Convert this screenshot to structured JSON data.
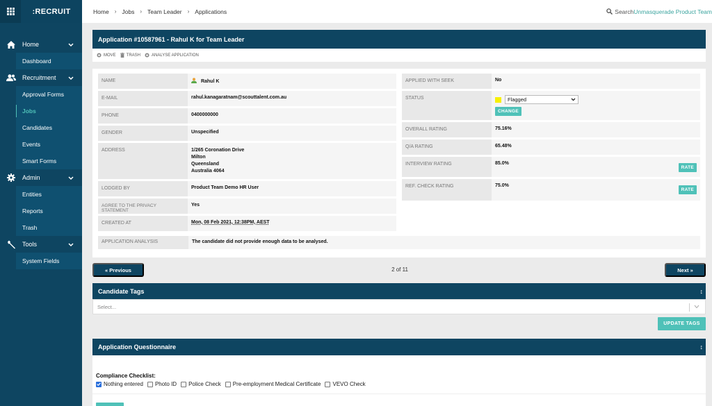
{
  "app": {
    "brand": ":RECRUIT"
  },
  "sidebar": {
    "groups": [
      {
        "label": "Home",
        "icon": "home-icon",
        "items": [
          {
            "label": "Dashboard",
            "active": false
          }
        ]
      },
      {
        "label": "Recruitment",
        "icon": "users-icon",
        "items": [
          {
            "label": "Approval Forms",
            "active": false
          },
          {
            "label": "Jobs",
            "active": true
          },
          {
            "label": "Candidates",
            "active": false
          },
          {
            "label": "Events",
            "active": false
          },
          {
            "label": "Smart Forms",
            "active": false
          }
        ]
      },
      {
        "label": "Admin",
        "icon": "gear-icon",
        "items": [
          {
            "label": "Entities",
            "active": false
          },
          {
            "label": "Reports",
            "active": false
          },
          {
            "label": "Trash",
            "active": false
          }
        ]
      },
      {
        "label": "Tools",
        "icon": "wrench-icon",
        "items": [
          {
            "label": "System Fields",
            "active": false
          }
        ]
      }
    ]
  },
  "topbar": {
    "breadcrumbs": [
      "Home",
      "Jobs",
      "Team Leader",
      "Applications"
    ],
    "search_label": "Search",
    "user_label": "Unmasquerade Product Team"
  },
  "application": {
    "title": "Application #10587961 - Rahul K for Team Leader",
    "actions": [
      {
        "label": "MOVE",
        "icon": "move-icon"
      },
      {
        "label": "TRASH",
        "icon": "trash-icon"
      },
      {
        "label": "ANALYSE APPLICATION",
        "icon": "analyse-icon"
      }
    ],
    "left_fields": {
      "name": {
        "label": "NAME",
        "value": "Rahul K"
      },
      "email": {
        "label": "E-MAIL",
        "value": "rahul.kanagaratnam@scouttalent.com.au"
      },
      "phone": {
        "label": "PHONE",
        "value": "0400000000"
      },
      "gender": {
        "label": "GENDER",
        "value": "Unspecified"
      },
      "address": {
        "label": "ADDRESS",
        "lines": [
          "1/265 Coronation Drive",
          "Milton",
          "Queensland",
          "Australia 4064"
        ]
      },
      "lodged_by": {
        "label": "LODGED BY",
        "value": "Product Team Demo HR User"
      },
      "privacy": {
        "label": "AGREE TO THE PRIVACY STATEMENT",
        "value": "Yes"
      },
      "created_at": {
        "label": "CREATED AT",
        "value": "Mon, 08 Feb 2021, 12:38PM, AEST"
      }
    },
    "analysis": {
      "label": "APPLICATION ANALYSIS",
      "value": "The candidate did not provide enough data to be analysed."
    },
    "right_fields": {
      "seek": {
        "label": "APPLIED WITH SEEK",
        "value": "No"
      },
      "status": {
        "label": "STATUS",
        "value": "Flagged",
        "color": "#f7f000",
        "button": "CHANGE"
      },
      "overall": {
        "label": "OVERALL RATING",
        "value": "75.16%"
      },
      "qa": {
        "label": "Q/A RATING",
        "value": "65.48%"
      },
      "interview": {
        "label": "INTERVIEW RATING",
        "value": "85.0%",
        "button": "RATE"
      },
      "ref_check": {
        "label": "REF. CHECK RATING",
        "value": "75.0%",
        "button": "RATE"
      }
    }
  },
  "pager": {
    "previous": "« Previous",
    "next": "Next »",
    "count": "2 of 11"
  },
  "tags": {
    "title": "Candidate Tags",
    "placeholder": "Select...",
    "update_button": "UPDATE TAGS"
  },
  "questionnaire": {
    "title": "Application Questionnaire",
    "checklist_label": "Compliance Checklist:",
    "options": [
      {
        "label": "Nothing entered",
        "checked": true
      },
      {
        "label": "Photo ID",
        "checked": false
      },
      {
        "label": "Police Check",
        "checked": false
      },
      {
        "label": "Pre-employment Medical Certificate",
        "checked": false
      },
      {
        "label": "VEVO Check",
        "checked": false
      }
    ]
  },
  "colors": {
    "navy": "#0e4561",
    "teal": "#4fc1b8",
    "rating_green": "#7ac143",
    "link": "#2a7a77"
  }
}
